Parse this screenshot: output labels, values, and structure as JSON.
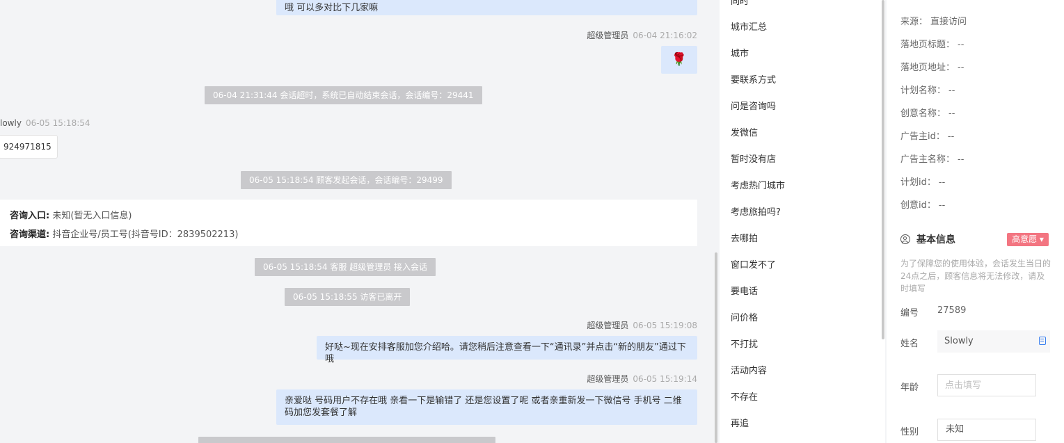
{
  "chat": {
    "msg1": {
      "text": "哦 可以多对比下几家嘛"
    },
    "msg2": {
      "sender": "超级管理员",
      "time": "06-04 21:16:02",
      "emoji": "🌹"
    },
    "sys1": "06-04 21:31:44 会话超时，系统已自动结束会话，会话编号：29441",
    "visitor_msg": {
      "sender": "lowly",
      "time": "06-05 15:18:54",
      "text": "924971815"
    },
    "sys2": "06-05 15:18:54 顾客发起会话，会话编号：29499",
    "info_card": {
      "entry_label": "咨询入口:",
      "entry_value": "未知(暂无入口信息)",
      "channel_label": "咨询渠道:",
      "channel_value": "抖音企业号/员工号(抖音号ID：2839502213)"
    },
    "sys3": "06-05 15:18:54 客服 超级管理员 接入会话",
    "sys4": "06-05 15:18:55 访客已离开",
    "msg3": {
      "sender": "超级管理员",
      "time": "06-05 15:19:08",
      "text": "好哒~现在安排客服加您介绍哈。请您稍后注意查看一下“通讯录”并点击“新的朋友”通过下哦"
    },
    "msg4": {
      "sender": "超级管理员",
      "time": "06-05 15:19:14",
      "text": "亲爱哒 号码用户不存在哦 亲看一下是输错了 还是您设置了呢 或者亲重新发一下微信号 手机号 二维码加您发套餐了解"
    }
  },
  "phrases": [
    "同时",
    "城市汇总",
    "城市",
    "要联系方式",
    "问是咨询吗",
    "发微信",
    "暂时没有店",
    "考虑热门城市",
    "考虑旅拍吗?",
    "去哪拍",
    "窗口发不了",
    "要电话",
    "问价格",
    "不打扰",
    "活动内容",
    "不存在",
    "再追"
  ],
  "details": {
    "source": {
      "label": "来源：",
      "value": "直接访问"
    },
    "landing_title": {
      "label": "落地页标题：",
      "value": "--"
    },
    "landing_url": {
      "label": "落地页地址：",
      "value": "--"
    },
    "plan_name": {
      "label": "计划名称：",
      "value": "--"
    },
    "creative_name": {
      "label": "创意名称：",
      "value": "--"
    },
    "advertiser_id": {
      "label": "广告主id：",
      "value": "--"
    },
    "advertiser_name": {
      "label": "广告主名称：",
      "value": "--"
    },
    "plan_id": {
      "label": "计划id：",
      "value": "--"
    },
    "creative_id": {
      "label": "创意id：",
      "value": "--"
    },
    "basic_title": "基本信息",
    "intent_badge": "高意愿 ▾",
    "notice": "为了保障您的使用体验，会话发生当日的24点之后，顾客信息将无法修改，请及时填写",
    "id_label": "编号",
    "id_value": "27589",
    "name_label": "姓名",
    "name_value": "Slowly",
    "age_label": "年龄",
    "age_placeholder": "点击填写",
    "gender_label": "性别",
    "gender_value": "未知"
  }
}
